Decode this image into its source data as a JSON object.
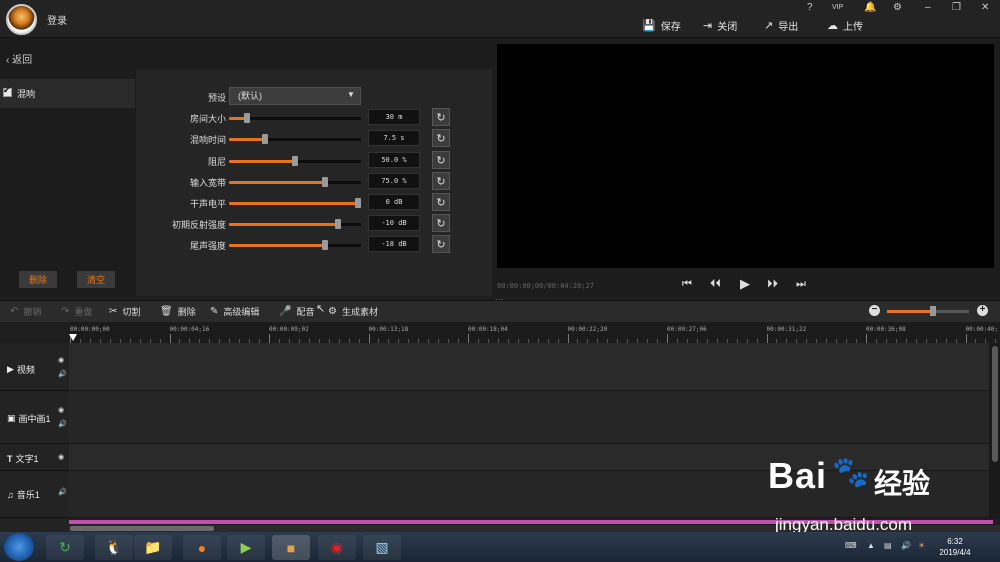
{
  "header": {
    "login": "登录",
    "top_icons": [
      "?",
      "VIP",
      "bell",
      "gear",
      "min",
      "max",
      "close"
    ],
    "buttons": [
      {
        "label": "保存",
        "icon": "save-icon"
      },
      {
        "label": "关闭",
        "icon": "exit-icon"
      },
      {
        "label": "导出",
        "icon": "export-icon"
      },
      {
        "label": "上传",
        "icon": "upload-icon"
      }
    ]
  },
  "left": {
    "back_label": "返回",
    "effect_item": "混响",
    "delete_label": "删除",
    "clear_label": "清空"
  },
  "params": {
    "preset_label": "预设",
    "preset_value": "(默认)",
    "rows": [
      {
        "label": "房间大小",
        "value": "30 m",
        "level": 0.12
      },
      {
        "label": "混响时间",
        "value": "7.5 s",
        "level": 0.26
      },
      {
        "label": "阻尼",
        "value": "50.0 %",
        "level": 0.5
      },
      {
        "label": "输入宽带",
        "value": "75.0 %",
        "level": 0.74
      },
      {
        "label": "干声电平",
        "value": "0 dB",
        "level": 1.0
      },
      {
        "label": "初期反射强度",
        "value": "-10 dB",
        "level": 0.84
      },
      {
        "label": "尾声强度",
        "value": "-18 dB",
        "level": 0.74
      }
    ]
  },
  "preview": {
    "timecode": "00:00:00;00/00:04:20;27"
  },
  "toolbar": {
    "undo": "撤销",
    "redo": "重做",
    "cut": "切割",
    "delete": "删除",
    "advanced_edit": "高级编辑",
    "dub": "配音",
    "generate": "生成素材",
    "zoom_level": 0.56
  },
  "ruler": {
    "ticks": [
      "00:00:00;00",
      "00:00:04;16",
      "00:00:09;02",
      "00:00:13;18",
      "00:00:18;04",
      "00:00:22;20",
      "00:00:27;06",
      "00:00:31;22",
      "00:00:36;08",
      "00:00:40;"
    ]
  },
  "tracks": [
    {
      "label": "视频",
      "icon": "play-icon"
    },
    {
      "label": "画中画1",
      "icon": "pip-icon"
    },
    {
      "label": "文字1",
      "icon": "text-icon"
    },
    {
      "label": "音乐1",
      "icon": "music-icon"
    }
  ],
  "taskbar": {
    "time": "6:32",
    "date": "2019/4/4"
  },
  "watermark": {
    "brand": "Bai",
    "brand2": "经验",
    "url": "jingyan.baidu.com"
  }
}
